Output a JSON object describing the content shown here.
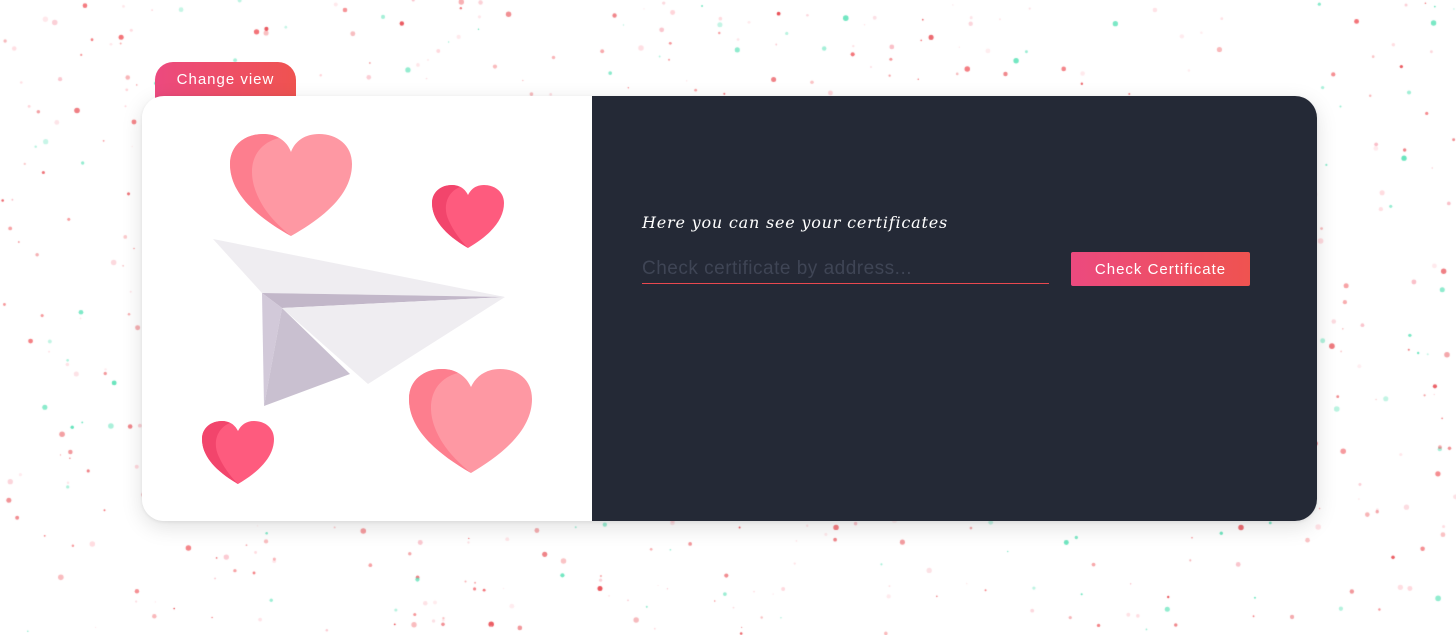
{
  "toolbar": {
    "change_view_label": "Change view"
  },
  "certificate_panel": {
    "heading": "Here you can see your certificates",
    "address_input": {
      "value": "",
      "placeholder": "Check certificate by address..."
    },
    "check_button_label": "Check Certificate"
  },
  "illustration": {
    "icon": "paper-plane-with-hearts",
    "colors": {
      "heart_light": "#fe98a3",
      "heart_light_shade": "#fd7e8e",
      "heart_bright": "#fe5b7e",
      "heart_bright_shade": "#f2456c",
      "plane_light": "#efedf1",
      "plane_shadow": "#c9c0d0"
    }
  },
  "theme": {
    "accent_start": "#ec4a7f",
    "accent_end": "#ef5350",
    "panel_dark": "#242936",
    "confetti_colors": [
      "#f26a6f",
      "#f9b8c2",
      "#5fe3b9",
      "#ffd0d6",
      "#e8484f"
    ]
  }
}
